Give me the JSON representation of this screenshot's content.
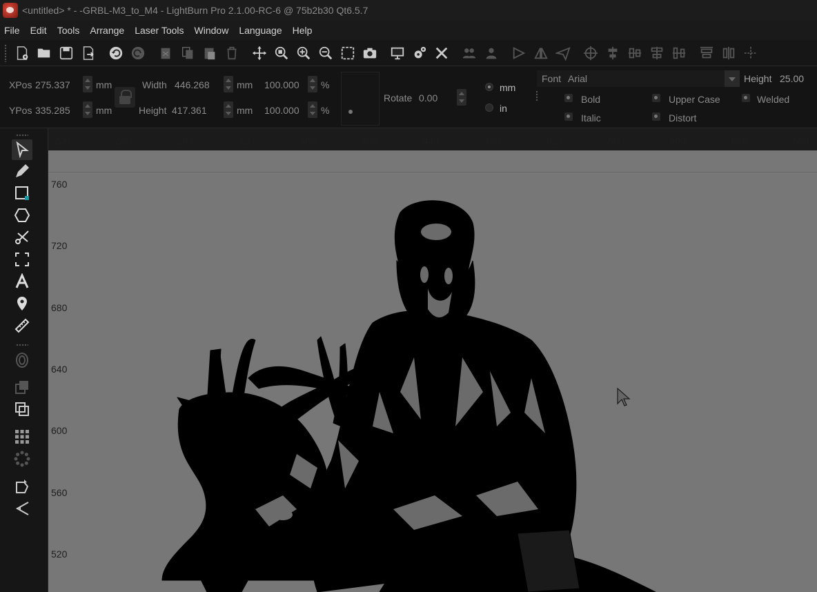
{
  "window": {
    "title": "<untitled> * - -GRBL-M3_to_M4 - LightBurn Pro 2.1.00-RC-6 @ 75b2b30 Qt6.5.7"
  },
  "menu": [
    "File",
    "Edit",
    "Tools",
    "Arrange",
    "Laser Tools",
    "Window",
    "Language",
    "Help"
  ],
  "toolbar_icons": [
    "new-file-icon",
    "open-folder-icon",
    "save-icon",
    "export-icon",
    "undo-icon",
    "redo-icon",
    "cut-icon",
    "copy-icon",
    "paste-icon",
    "delete-icon",
    "move-icon",
    "zoom-selection-icon",
    "zoom-in-icon",
    "zoom-out-icon",
    "frame-icon",
    "camera-icon",
    "monitor-icon",
    "settings-icon",
    "tools-icon",
    "group-icon",
    "ungroup-icon",
    "mirror-h-icon",
    "mirror-v-icon",
    "send-icon",
    "target-icon",
    "align-center-h-icon",
    "align-v-icon",
    "align-left-icon",
    "distribute-icon",
    "align-top-icon",
    "align-middle-icon",
    "center-icon"
  ],
  "properties": {
    "xpos_label": "XPos",
    "xpos_value": "275.337",
    "ypos_label": "YPos",
    "ypos_value": "335.285",
    "width_label": "Width",
    "width_value": "446.268",
    "height_label": "Height",
    "height_value": "417.361",
    "unit": "mm",
    "scale_x": "100.000",
    "scale_y": "100.000",
    "percent": "%",
    "rotate_label": "Rotate",
    "rotate_value": "0.00",
    "unit_mm": "mm",
    "unit_in": "in"
  },
  "font": {
    "font_label": "Font",
    "font_value": "Arial",
    "height_label": "Height",
    "height_value": "25.00",
    "bold": "Bold",
    "italic": "Italic",
    "upper_case": "Upper Case",
    "distort": "Distort",
    "welded": "Welded"
  },
  "ruler": {
    "x_ticks": [
      "200",
      "240",
      "280",
      "320",
      "360",
      "400",
      "440",
      "480",
      "520",
      "560",
      "600",
      "640",
      "680"
    ],
    "y_ticks": [
      "760",
      "720",
      "680",
      "640",
      "600",
      "560",
      "520"
    ]
  },
  "left_tools": [
    "select-icon",
    "pencil-icon",
    "rectangle-icon",
    "polygon-icon",
    "scissors-icon",
    "frame-select-icon",
    "text-icon",
    "position-marker-icon",
    "measure-icon",
    "offset-icon",
    "boolean-union-icon",
    "boolean-diff-icon",
    "grid-array-icon",
    "circular-array-icon",
    "node-edit-icon",
    "tab-icon"
  ],
  "colors": {
    "canvas": "#777777",
    "chrome": "#161616"
  }
}
